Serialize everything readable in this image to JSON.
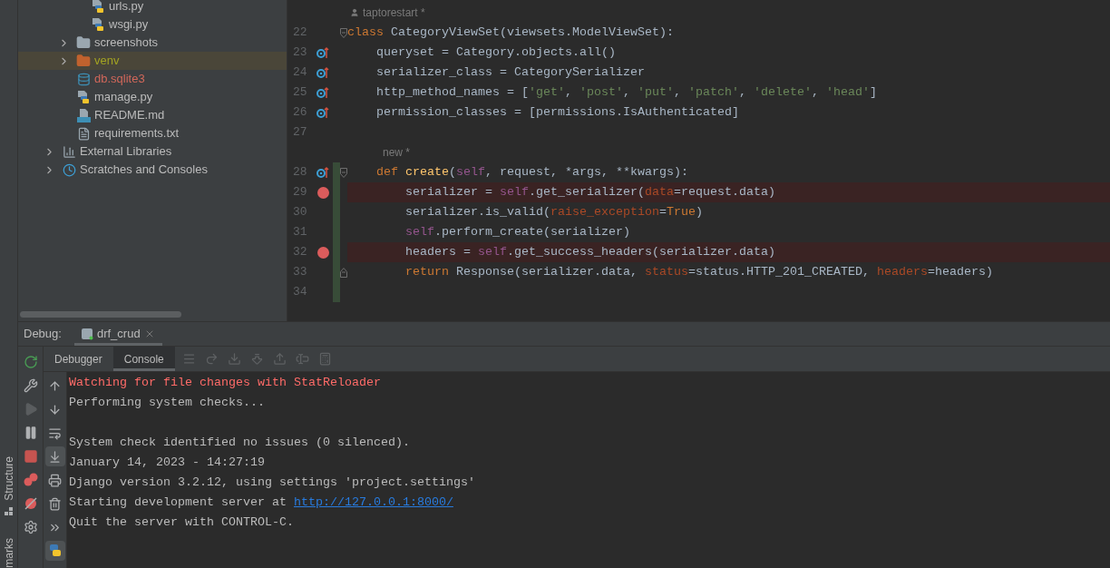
{
  "side_strip": {
    "labels": [
      "Structure",
      "marks"
    ]
  },
  "project_tree": [
    {
      "children": [
        {
          "children": [
            {
              "label": "urls.py",
              "kind": "python",
              "selected": false
            },
            {
              "label": "wsgi.py",
              "kind": "python",
              "selected": false
            }
          ]
        },
        {
          "label": "screenshots",
          "kind": "folder",
          "selected": false,
          "expanded": false
        },
        {
          "label": "venv",
          "kind": "excluded-folder",
          "selected": true,
          "expanded": false
        },
        {
          "label": "db.sqlite3",
          "kind": "database",
          "selected": false
        },
        {
          "label": "manage.py",
          "kind": "python",
          "selected": false
        },
        {
          "label": "README.md",
          "kind": "markdown",
          "selected": false
        },
        {
          "label": "requirements.txt",
          "kind": "text",
          "selected": false
        }
      ]
    },
    {
      "label": "External Libraries",
      "kind": "libraries",
      "selected": false,
      "expanded": false
    },
    {
      "label": "Scratches and Consoles",
      "kind": "scratches",
      "selected": false,
      "expanded": false
    }
  ],
  "editor": {
    "lines": [
      {
        "kind": "author-hint",
        "text": "taptorestart *"
      },
      {
        "kind": "code",
        "number": "22",
        "override": false,
        "breakpoint": false,
        "fold_start": true,
        "fold_end": false,
        "changed": false,
        "tokens": [
          {
            "kind": "kw",
            "s": "class"
          },
          {
            "kind": "plain",
            "s": " CategoryViewSet(viewsets.ModelViewSet):"
          }
        ]
      },
      {
        "kind": "code",
        "number": "23",
        "override": true,
        "breakpoint": false,
        "fold_start": false,
        "fold_end": false,
        "changed": false,
        "tokens": [
          {
            "kind": "plain",
            "s": "    queryset = Category.objects.all()"
          }
        ]
      },
      {
        "kind": "code",
        "number": "24",
        "override": true,
        "breakpoint": false,
        "fold_start": false,
        "fold_end": false,
        "changed": false,
        "tokens": [
          {
            "kind": "plain",
            "s": "    serializer_class = CategorySerializer"
          }
        ]
      },
      {
        "kind": "code",
        "number": "25",
        "override": true,
        "breakpoint": false,
        "fold_start": false,
        "fold_end": false,
        "changed": false,
        "tokens": [
          {
            "kind": "plain",
            "s": "    http_method_names = ["
          },
          {
            "kind": "str",
            "s": "'get'"
          },
          {
            "kind": "plain",
            "s": ", "
          },
          {
            "kind": "str",
            "s": "'post'"
          },
          {
            "kind": "plain",
            "s": ", "
          },
          {
            "kind": "str",
            "s": "'put'"
          },
          {
            "kind": "plain",
            "s": ", "
          },
          {
            "kind": "str",
            "s": "'patch'"
          },
          {
            "kind": "plain",
            "s": ", "
          },
          {
            "kind": "str",
            "s": "'delete'"
          },
          {
            "kind": "plain",
            "s": ", "
          },
          {
            "kind": "str",
            "s": "'head'"
          },
          {
            "kind": "plain",
            "s": "]"
          }
        ]
      },
      {
        "kind": "code",
        "number": "26",
        "override": true,
        "breakpoint": false,
        "fold_start": false,
        "fold_end": false,
        "changed": false,
        "tokens": [
          {
            "kind": "plain",
            "s": "    permission_classes = [permissions.IsAuthenticated]"
          }
        ]
      },
      {
        "kind": "code",
        "number": "27",
        "override": false,
        "breakpoint": false,
        "fold_start": false,
        "fold_end": false,
        "changed": false
      },
      {
        "kind": "hint",
        "text": "new *"
      },
      {
        "kind": "code",
        "number": "28",
        "override": true,
        "breakpoint": false,
        "fold_start": true,
        "fold_end": false,
        "changed": true,
        "tokens": [
          {
            "kind": "kw",
            "s": "    def "
          },
          {
            "kind": "fn",
            "s": "create"
          },
          {
            "kind": "plain",
            "s": "("
          },
          {
            "kind": "self",
            "s": "self"
          },
          {
            "kind": "plain",
            "s": ", request, *args, **kwargs):"
          }
        ]
      },
      {
        "kind": "code",
        "number": "29",
        "override": false,
        "breakpoint": true,
        "fold_start": false,
        "fold_end": false,
        "changed": true,
        "tokens": [
          {
            "kind": "plain",
            "s": "        serializer = "
          },
          {
            "kind": "self",
            "s": "self"
          },
          {
            "kind": "plain",
            "s": ".get_serializer("
          },
          {
            "kind": "param",
            "s": "data"
          },
          {
            "kind": "plain",
            "s": "=request.data)"
          }
        ]
      },
      {
        "kind": "code",
        "number": "30",
        "override": false,
        "breakpoint": false,
        "fold_start": false,
        "fold_end": false,
        "changed": true,
        "tokens": [
          {
            "kind": "plain",
            "s": "        serializer.is_valid("
          },
          {
            "kind": "param",
            "s": "raise_exception"
          },
          {
            "kind": "plain",
            "s": "="
          },
          {
            "kind": "kw",
            "s": "True"
          },
          {
            "kind": "plain",
            "s": ")"
          }
        ]
      },
      {
        "kind": "code",
        "number": "31",
        "override": false,
        "breakpoint": false,
        "fold_start": false,
        "fold_end": false,
        "changed": true,
        "tokens": [
          {
            "kind": "self",
            "s": "        self"
          },
          {
            "kind": "plain",
            "s": ".perform_create(serializer)"
          }
        ]
      },
      {
        "kind": "code",
        "number": "32",
        "override": false,
        "breakpoint": true,
        "fold_start": false,
        "fold_end": false,
        "changed": true,
        "tokens": [
          {
            "kind": "plain",
            "s": "        headers = "
          },
          {
            "kind": "self",
            "s": "self"
          },
          {
            "kind": "plain",
            "s": ".get_success_headers(serializer.data)"
          }
        ]
      },
      {
        "kind": "code",
        "number": "33",
        "override": false,
        "breakpoint": false,
        "fold_start": false,
        "fold_end": true,
        "changed": true,
        "tokens": [
          {
            "kind": "kw",
            "s": "        return"
          },
          {
            "kind": "plain",
            "s": " Response(serializer.data, "
          },
          {
            "kind": "param",
            "s": "status"
          },
          {
            "kind": "plain",
            "s": "=status.HTTP_201_CREATED, "
          },
          {
            "kind": "param",
            "s": "headers"
          },
          {
            "kind": "plain",
            "s": "=headers)"
          }
        ]
      },
      {
        "kind": "code",
        "number": "34",
        "override": false,
        "breakpoint": false,
        "fold_start": false,
        "fold_end": false,
        "changed": true
      }
    ]
  },
  "debug": {
    "label": "Debug:",
    "session_tab": {
      "label": "drf_crud",
      "selected": true
    },
    "left_tools": [
      {
        "kind": "rerun",
        "disabled": false
      },
      {
        "kind": "wrench",
        "disabled": false
      },
      {
        "kind": "resume",
        "disabled": true
      },
      {
        "kind": "pause",
        "disabled": false
      },
      {
        "kind": "stop",
        "disabled": false
      },
      {
        "kind": "breakpoints",
        "disabled": false
      },
      {
        "kind": "mute",
        "disabled": false
      },
      {
        "kind": "settings",
        "disabled": false
      }
    ],
    "tabs": [
      {
        "label": "Debugger",
        "selected": false
      },
      {
        "label": "Console",
        "selected": true
      }
    ],
    "step_tools": [
      {
        "kind": "menu"
      },
      {
        "kind": "step-over"
      },
      {
        "kind": "step-into"
      },
      {
        "kind": "force-step-into"
      },
      {
        "kind": "step-out"
      },
      {
        "kind": "run-to-cursor"
      },
      {
        "kind": "evaluate"
      }
    ],
    "console_tools": [
      {
        "kind": "up",
        "selected": false
      },
      {
        "kind": "down",
        "selected": false
      },
      {
        "kind": "wrap",
        "selected": false
      },
      {
        "kind": "scroll-end",
        "selected": true
      },
      {
        "kind": "print",
        "selected": false
      },
      {
        "kind": "trash",
        "selected": false
      },
      {
        "kind": "more",
        "selected": false
      },
      {
        "kind": "python-console",
        "selected": true
      }
    ],
    "console": [
      {
        "kind": "error",
        "text": "Watching for file changes with StatReloader"
      },
      {
        "kind": "plain",
        "text": "Performing system checks..."
      },
      {
        "kind": "blank"
      },
      {
        "kind": "plain",
        "text": "System check identified no issues (0 silenced)."
      },
      {
        "kind": "plain",
        "text": "January 14, 2023 - 14:27:19"
      },
      {
        "kind": "plain",
        "text": "Django version 3.2.12, using settings 'project.settings'"
      },
      {
        "kind": "link",
        "text": "Starting development server at ",
        "link": "http://127.0.0.1:8000/"
      },
      {
        "kind": "plain",
        "text": "Quit the server with CONTROL-C."
      }
    ]
  }
}
